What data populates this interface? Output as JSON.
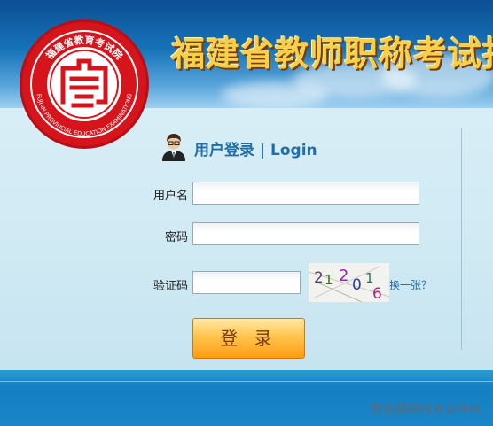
{
  "header": {
    "banner_title": "福建省教师职称考试报",
    "seal_text": "福建省教育考试院",
    "seal_text_en": "FUJIAN PROVINCIAL EDUCATION EXAMINATIONS"
  },
  "login": {
    "title": "用户登录 | Login",
    "username_label": "用户名",
    "username_value": "",
    "password_label": "密码",
    "password_value": "",
    "captcha_label": "验证码",
    "captcha_value": "",
    "captcha_digits": [
      "2",
      "1",
      "2",
      "0",
      "1",
      "6"
    ],
    "refresh_link": "换一张？",
    "submit_label": "登 录"
  },
  "footer": {
    "support_text": "报名期间技术支持电"
  },
  "colors": {
    "accent": "#1f6ea8",
    "seal_red": "#d5141c",
    "button_orange": "#ffb020"
  },
  "icons": [
    "user-avatar-icon"
  ]
}
